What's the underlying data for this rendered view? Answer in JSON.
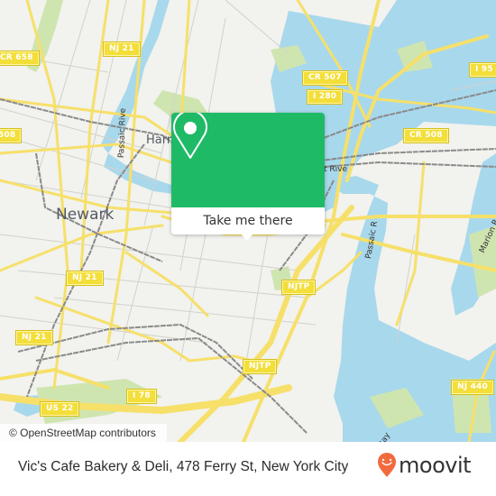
{
  "map": {
    "place_labels": [
      {
        "id": "newark",
        "text": "Newark"
      },
      {
        "id": "harrison",
        "text": "Harr"
      }
    ],
    "river_labels": [
      {
        "id": "passaic-river-north",
        "text": "Passaic Rive"
      },
      {
        "id": "passaic-river-east",
        "text": "t Rive"
      },
      {
        "id": "passaic-river-south",
        "text": "Passaic R"
      },
      {
        "id": "marion-reach",
        "text": "Marion R"
      },
      {
        "id": "newark-bay",
        "text": "Bay"
      }
    ],
    "route_shields": [
      {
        "id": "nj21-top",
        "text": "NJ 21"
      },
      {
        "id": "cr658",
        "text": "CR 658"
      },
      {
        "id": "cr507",
        "text": "CR 507"
      },
      {
        "id": "i95",
        "text": "I 95"
      },
      {
        "id": "i280",
        "text": "I 280"
      },
      {
        "id": "cr508-left",
        "text": "508"
      },
      {
        "id": "cr508-right",
        "text": "CR 508"
      },
      {
        "id": "nj21-mid",
        "text": "NJ 21"
      },
      {
        "id": "nj21-low",
        "text": "NJ 21"
      },
      {
        "id": "njtp-upper",
        "text": "NJTP"
      },
      {
        "id": "njtp-lower",
        "text": "NJTP"
      },
      {
        "id": "i78",
        "text": "I 78"
      },
      {
        "id": "us22",
        "text": "US 22"
      },
      {
        "id": "nj440",
        "text": "NJ 440"
      }
    ],
    "colors": {
      "land": "#f2f2ee",
      "water": "#a8d8ec",
      "park": "#cfe5b0",
      "road": "#f6e06a",
      "minor_road": "#d2d2cc",
      "rail": "#888888"
    }
  },
  "popup": {
    "cta_label": "Take me there",
    "color": "#1fba66",
    "icon": "map-pin-icon"
  },
  "attribution": "© OpenStreetMap contributors",
  "footer": {
    "place_title": "Vic's Cafe Bakery & Deli, 478 Ferry St, New York City",
    "brand": "moovit",
    "brand_color": "#f26a3d"
  }
}
